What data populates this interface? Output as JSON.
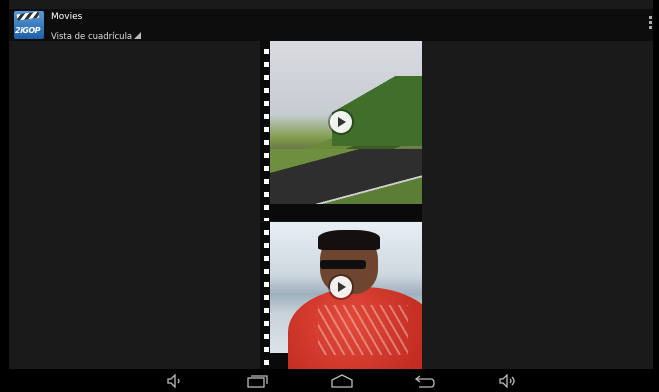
{
  "action_bar": {
    "app_icon_text": "2iGOP",
    "title": "Movies",
    "subtitle": "Vista de cuadrícula"
  },
  "grid": {
    "items": [
      {
        "name": "video-thumbnail-race-track",
        "play_icon": "play-icon"
      },
      {
        "name": "video-thumbnail-man-red-shirt",
        "play_icon": "play-icon"
      }
    ]
  },
  "nav_bar": {
    "buttons": [
      "volume-down-icon",
      "recent-apps-icon",
      "home-icon",
      "back-icon",
      "volume-up-icon"
    ]
  },
  "colors": {
    "background": "#1a1a1a",
    "action_bar": "#0d0d0d",
    "nav_bar": "#000000"
  }
}
